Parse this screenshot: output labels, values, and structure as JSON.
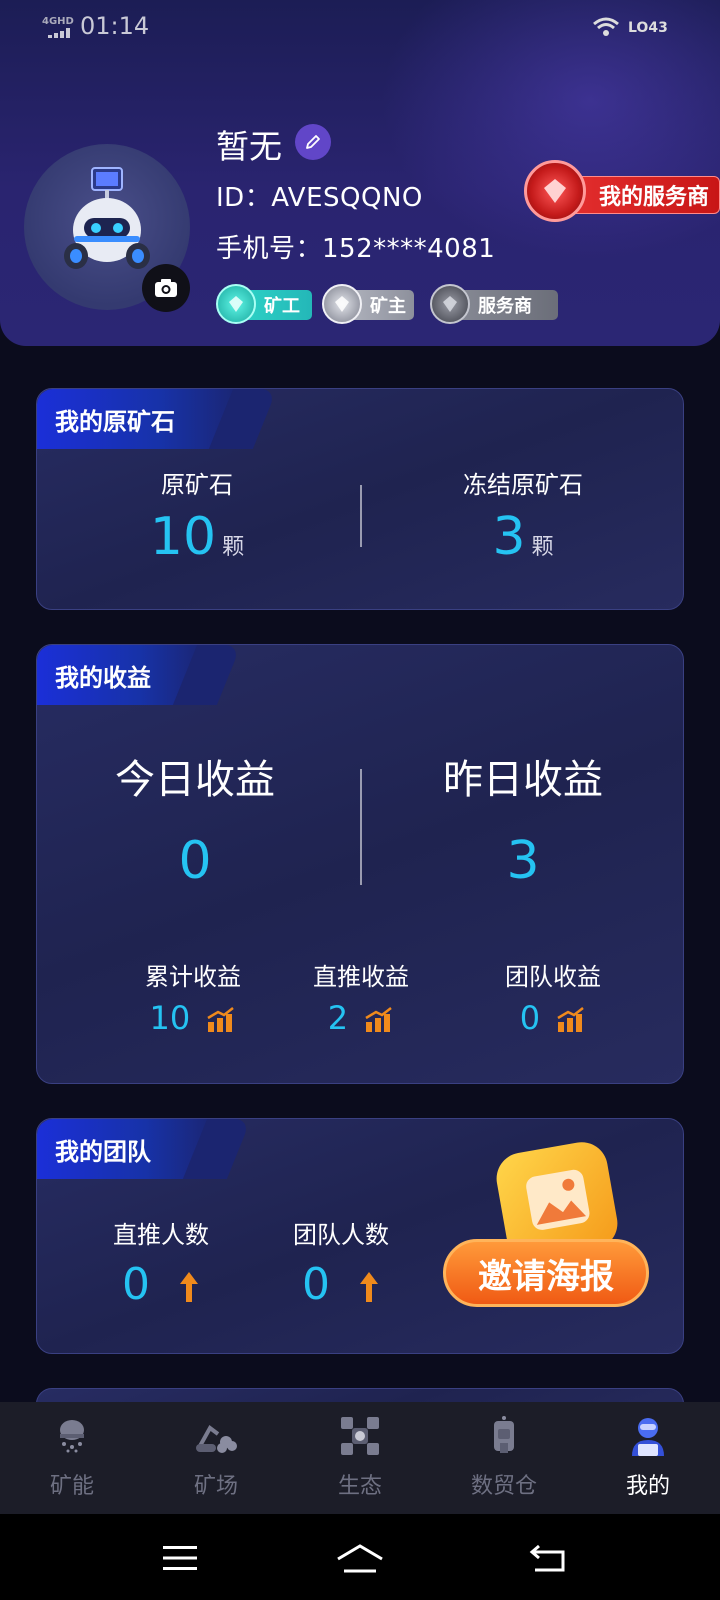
{
  "status_bar": {
    "network": "4GHD",
    "time": "01:14",
    "battery": "LO43"
  },
  "profile": {
    "name": "暂无",
    "id_text": "ID：AVESQQNO",
    "phone_text": "手机号：152****4081",
    "badges": [
      {
        "label": "矿工",
        "color": "#2fd9c9"
      },
      {
        "label": "矿主",
        "color": "#b9bcc6"
      },
      {
        "label": "服务商",
        "color": "#8c8f9a"
      }
    ],
    "provider_tag": "我的服务商"
  },
  "ore_card": {
    "title": "我的原矿石",
    "left": {
      "label": "原矿石",
      "value": "10",
      "unit": "颗"
    },
    "right": {
      "label": "冻结原矿石",
      "value": "3",
      "unit": "颗"
    }
  },
  "earnings_card": {
    "title": "我的收益",
    "today": {
      "label": "今日收益",
      "value": "0"
    },
    "yesterday": {
      "label": "昨日收益",
      "value": "3"
    },
    "stats": [
      {
        "label": "累计收益",
        "value": "10"
      },
      {
        "label": "直推收益",
        "value": "2"
      },
      {
        "label": "团队收益",
        "value": "0"
      }
    ]
  },
  "team_card": {
    "title": "我的团队",
    "direct": {
      "label": "直推人数",
      "value": "0"
    },
    "team": {
      "label": "团队人数",
      "value": "0"
    },
    "poster_button": "邀请海报"
  },
  "tabbar": {
    "tabs": [
      {
        "label": "矿能",
        "icon": "mining-energy-icon"
      },
      {
        "label": "矿场",
        "icon": "mine-field-icon"
      },
      {
        "label": "生态",
        "icon": "ecology-icon"
      },
      {
        "label": "数贸仓",
        "icon": "warehouse-icon"
      },
      {
        "label": "我的",
        "icon": "profile-icon",
        "active": true
      }
    ]
  },
  "colors": {
    "accent_number": "#25c3f2",
    "trend_orange": "#f08a1c",
    "active_tab": "#ffffff"
  }
}
